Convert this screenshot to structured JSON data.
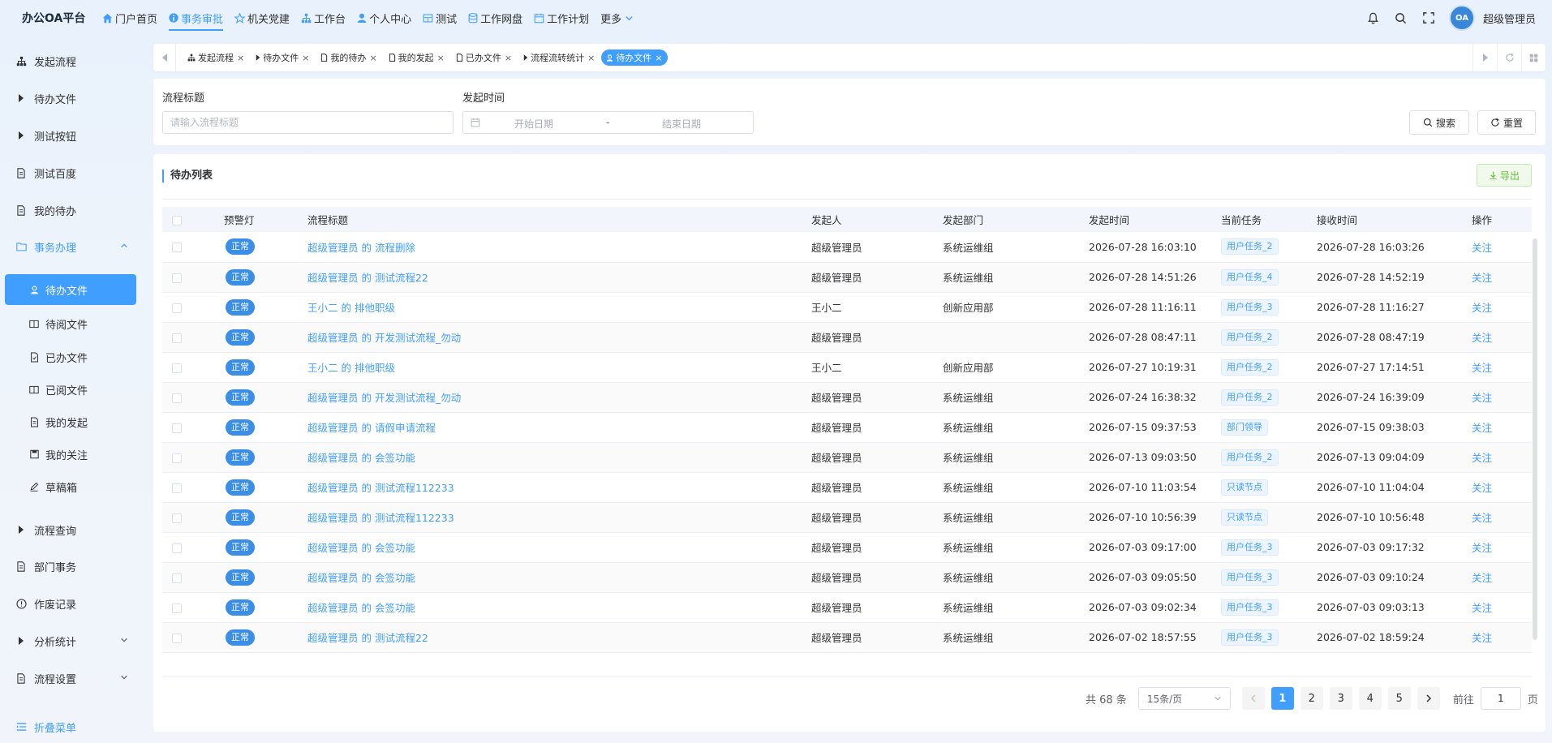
{
  "brand": "办公OA平台",
  "topnav": [
    {
      "label": "门户首页",
      "icon": "home-icon",
      "active": false
    },
    {
      "label": "事务审批",
      "icon": "info-icon",
      "active": true
    },
    {
      "label": "机关党建",
      "icon": "star-icon",
      "active": false
    },
    {
      "label": "工作台",
      "icon": "org-icon",
      "active": false
    },
    {
      "label": "个人中心",
      "icon": "user-icon",
      "active": false
    },
    {
      "label": "测试",
      "icon": "grid-icon",
      "active": false
    },
    {
      "label": "工作网盘",
      "icon": "database-icon",
      "active": false
    },
    {
      "label": "工作计划",
      "icon": "calendar-icon",
      "active": false
    },
    {
      "label": "更多",
      "icon": "",
      "active": false
    }
  ],
  "header": {
    "username": "超级管理员",
    "avatar_text": "OA"
  },
  "sidebar": {
    "items": [
      {
        "label": "发起流程"
      },
      {
        "label": "待办文件"
      },
      {
        "label": "测试按钮"
      },
      {
        "label": "测试百度"
      },
      {
        "label": "我的待办"
      },
      {
        "label": "事务办理"
      },
      {
        "label": "待办文件"
      },
      {
        "label": "待阅文件"
      },
      {
        "label": "已办文件"
      },
      {
        "label": "已阅文件"
      },
      {
        "label": "我的发起"
      },
      {
        "label": "我的关注"
      },
      {
        "label": "草稿箱"
      },
      {
        "label": "流程查询"
      },
      {
        "label": "部门事务"
      },
      {
        "label": "作废记录"
      },
      {
        "label": "分析统计"
      },
      {
        "label": "流程设置"
      }
    ],
    "collapse_label": "折叠菜单"
  },
  "tags": [
    {
      "label": "发起流程"
    },
    {
      "label": "待办文件"
    },
    {
      "label": "我的待办"
    },
    {
      "label": "我的发起"
    },
    {
      "label": "已办文件"
    },
    {
      "label": "流程流转统计"
    },
    {
      "label": "待办文件"
    }
  ],
  "search": {
    "title_label": "流程标题",
    "title_placeholder": "请输入流程标题",
    "time_label": "发起时间",
    "start_placeholder": "开始日期",
    "range_sep": "-",
    "end_placeholder": "结束日期",
    "search_btn": "搜索",
    "reset_btn": "重置"
  },
  "list": {
    "title": "待办列表",
    "export_btn": "导出",
    "columns": [
      "预警灯",
      "流程标题",
      "发起人",
      "发起部门",
      "发起时间",
      "当前任务",
      "接收时间",
      "操作"
    ],
    "rows": [
      {
        "status": "正常",
        "title": "超级管理员 的 流程删除",
        "initiator": "超级管理员",
        "dept": "系统运维组",
        "start": "2026-07-28 16:03:10",
        "task": "用户任务_2",
        "recv": "2026-07-28 16:03:26",
        "op": "关注"
      },
      {
        "status": "正常",
        "title": "超级管理员 的 测试流程22",
        "initiator": "超级管理员",
        "dept": "系统运维组",
        "start": "2026-07-28 14:51:26",
        "task": "用户任务_4",
        "recv": "2026-07-28 14:52:19",
        "op": "关注"
      },
      {
        "status": "正常",
        "title": "王小二 的 排他职级",
        "initiator": "王小二",
        "dept": "创新应用部",
        "start": "2026-07-28 11:16:11",
        "task": "用户任务_3",
        "recv": "2026-07-28 11:16:27",
        "op": "关注"
      },
      {
        "status": "正常",
        "title": "超级管理员 的 开发测试流程_勿动",
        "initiator": "超级管理员",
        "dept": "",
        "start": "2026-07-28 08:47:11",
        "task": "用户任务_2",
        "recv": "2026-07-28 08:47:19",
        "op": "关注"
      },
      {
        "status": "正常",
        "title": "王小二 的 排他职级",
        "initiator": "王小二",
        "dept": "创新应用部",
        "start": "2026-07-27 10:19:31",
        "task": "用户任务_2",
        "recv": "2026-07-27 17:14:51",
        "op": "关注"
      },
      {
        "status": "正常",
        "title": "超级管理员 的 开发测试流程_勿动",
        "initiator": "超级管理员",
        "dept": "系统运维组",
        "start": "2026-07-24 16:38:32",
        "task": "用户任务_2",
        "recv": "2026-07-24 16:39:09",
        "op": "关注"
      },
      {
        "status": "正常",
        "title": "超级管理员 的 请假申请流程",
        "initiator": "超级管理员",
        "dept": "系统运维组",
        "start": "2026-07-15 09:37:53",
        "task": "部门领导",
        "recv": "2026-07-15 09:38:03",
        "op": "关注"
      },
      {
        "status": "正常",
        "title": "超级管理员 的 会签功能",
        "initiator": "超级管理员",
        "dept": "系统运维组",
        "start": "2026-07-13 09:03:50",
        "task": "用户任务_2",
        "recv": "2026-07-13 09:04:09",
        "op": "关注"
      },
      {
        "status": "正常",
        "title": "超级管理员 的 测试流程112233",
        "initiator": "超级管理员",
        "dept": "系统运维组",
        "start": "2026-07-10 11:03:54",
        "task": "只读节点",
        "recv": "2026-07-10 11:04:04",
        "op": "关注"
      },
      {
        "status": "正常",
        "title": "超级管理员 的 测试流程112233",
        "initiator": "超级管理员",
        "dept": "系统运维组",
        "start": "2026-07-10 10:56:39",
        "task": "只读节点",
        "recv": "2026-07-10 10:56:48",
        "op": "关注"
      },
      {
        "status": "正常",
        "title": "超级管理员 的 会签功能",
        "initiator": "超级管理员",
        "dept": "系统运维组",
        "start": "2026-07-03 09:17:00",
        "task": "用户任务_3",
        "recv": "2026-07-03 09:17:32",
        "op": "关注"
      },
      {
        "status": "正常",
        "title": "超级管理员 的 会签功能",
        "initiator": "超级管理员",
        "dept": "系统运维组",
        "start": "2026-07-03 09:05:50",
        "task": "用户任务_3",
        "recv": "2026-07-03 09:10:24",
        "op": "关注"
      },
      {
        "status": "正常",
        "title": "超级管理员 的 会签功能",
        "initiator": "超级管理员",
        "dept": "系统运维组",
        "start": "2026-07-03 09:02:34",
        "task": "用户任务_3",
        "recv": "2026-07-03 09:03:13",
        "op": "关注"
      },
      {
        "status": "正常",
        "title": "超级管理员 的 测试流程22",
        "initiator": "超级管理员",
        "dept": "系统运维组",
        "start": "2026-07-02 18:57:55",
        "task": "用户任务_3",
        "recv": "2026-07-02 18:59:24",
        "op": "关注"
      }
    ]
  },
  "pagination": {
    "total": "共 68 条",
    "page_size": "15条/页",
    "pages": [
      "1",
      "2",
      "3",
      "4",
      "5"
    ],
    "current": "1",
    "goto_label": "前往",
    "goto_value": "1",
    "goto_suffix": "页"
  }
}
